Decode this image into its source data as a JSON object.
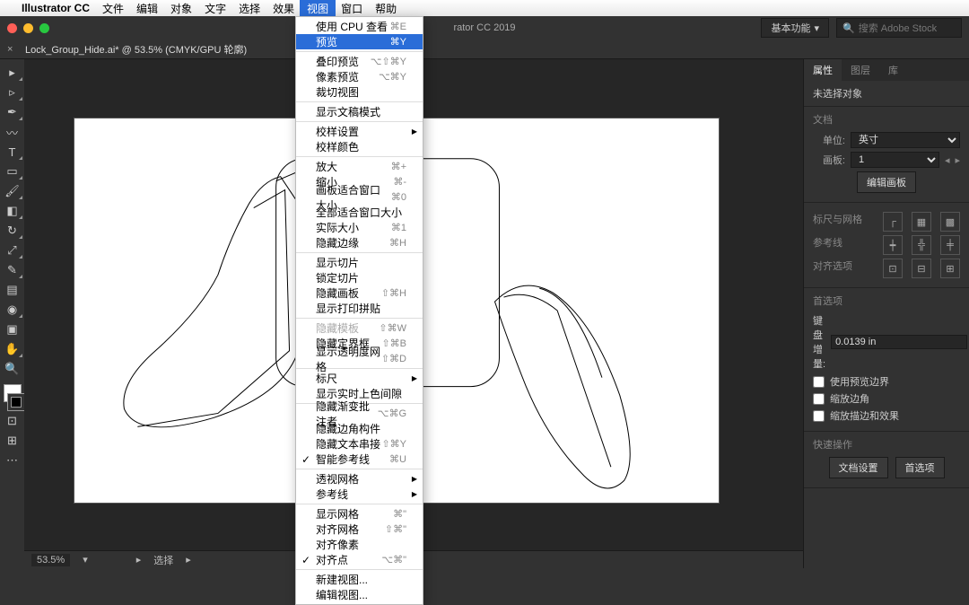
{
  "menubar": {
    "app": "Illustrator CC",
    "items": [
      "文件",
      "编辑",
      "对象",
      "文字",
      "选择",
      "效果",
      "视图",
      "窗口",
      "帮助"
    ],
    "active_index": 6
  },
  "titlebar": {
    "title": "rator CC 2019",
    "workspace": "基本功能",
    "search_placeholder": "搜索 Adobe Stock"
  },
  "doctab": {
    "label": "Lock_Group_Hide.ai* @ 53.5% (CMYK/GPU 轮廓)"
  },
  "menu": {
    "groups": [
      [
        {
          "label": "使用 CPU 查看",
          "sc": "⌘E"
        },
        {
          "label": "预览",
          "sc": "⌘Y",
          "hl": true
        }
      ],
      [
        {
          "label": "叠印预览",
          "sc": "⌥⇧⌘Y"
        },
        {
          "label": "像素预览",
          "sc": "⌥⌘Y"
        },
        {
          "label": "裁切视图"
        }
      ],
      [
        {
          "label": "显示文稿模式"
        }
      ],
      [
        {
          "label": "校样设置",
          "arrow": true
        },
        {
          "label": "校样颜色"
        }
      ],
      [
        {
          "label": "放大",
          "sc": "⌘+"
        },
        {
          "label": "缩小",
          "sc": "⌘-"
        },
        {
          "label": "画板适合窗口大小",
          "sc": "⌘0"
        },
        {
          "label": "全部适合窗口大小"
        },
        {
          "label": "实际大小",
          "sc": "⌘1"
        },
        {
          "label": "隐藏边缘",
          "sc": "⌘H"
        }
      ],
      [
        {
          "label": "显示切片"
        },
        {
          "label": "锁定切片"
        },
        {
          "label": "隐藏画板",
          "sc": "⇧⌘H"
        },
        {
          "label": "显示打印拼贴"
        }
      ],
      [
        {
          "label": "隐藏模板",
          "sc": "⇧⌘W",
          "dis": true
        },
        {
          "label": "隐藏定界框",
          "sc": "⇧⌘B"
        },
        {
          "label": "显示透明度网格",
          "sc": "⇧⌘D"
        }
      ],
      [
        {
          "label": "标尺",
          "arrow": true
        },
        {
          "label": "显示实时上色间隙"
        }
      ],
      [
        {
          "label": "隐藏渐变批注者",
          "sc": "⌥⌘G"
        },
        {
          "label": "隐藏边角构件"
        },
        {
          "label": "隐藏文本串接",
          "sc": "⇧⌘Y"
        },
        {
          "label": "智能参考线",
          "sc": "⌘U",
          "check": true
        }
      ],
      [
        {
          "label": "透视网格",
          "arrow": true
        },
        {
          "label": "参考线",
          "arrow": true
        }
      ],
      [
        {
          "label": "显示网格",
          "sc": "⌘\""
        },
        {
          "label": "对齐网格",
          "sc": "⇧⌘\""
        },
        {
          "label": "对齐像素"
        },
        {
          "label": "对齐点",
          "sc": "⌥⌘\"",
          "check": true
        }
      ],
      [
        {
          "label": "新建视图..."
        },
        {
          "label": "编辑视图..."
        }
      ]
    ]
  },
  "statusbar": {
    "zoom": "53.5%",
    "sel": "选择"
  },
  "rpanel": {
    "tabs": [
      "属性",
      "图层",
      "库"
    ],
    "no_selection": "未选择对象",
    "doc_hdr": "文档",
    "unit_lbl": "单位:",
    "unit_val": "英寸",
    "artboard_lbl": "画板:",
    "artboard_val": "1",
    "edit_artboard": "编辑画板",
    "ruler_hdr": "标尺与网格",
    "guides_hdr": "参考线",
    "align_hdr": "对齐选项",
    "prefs_hdr": "首选项",
    "key_lbl": "键盘增量:",
    "key_val": "0.0139 in",
    "chk1": "使用预览边界",
    "chk2": "缩放边角",
    "chk3": "缩放描边和效果",
    "quick_hdr": "快速操作",
    "btn1": "文档设置",
    "btn2": "首选项"
  }
}
